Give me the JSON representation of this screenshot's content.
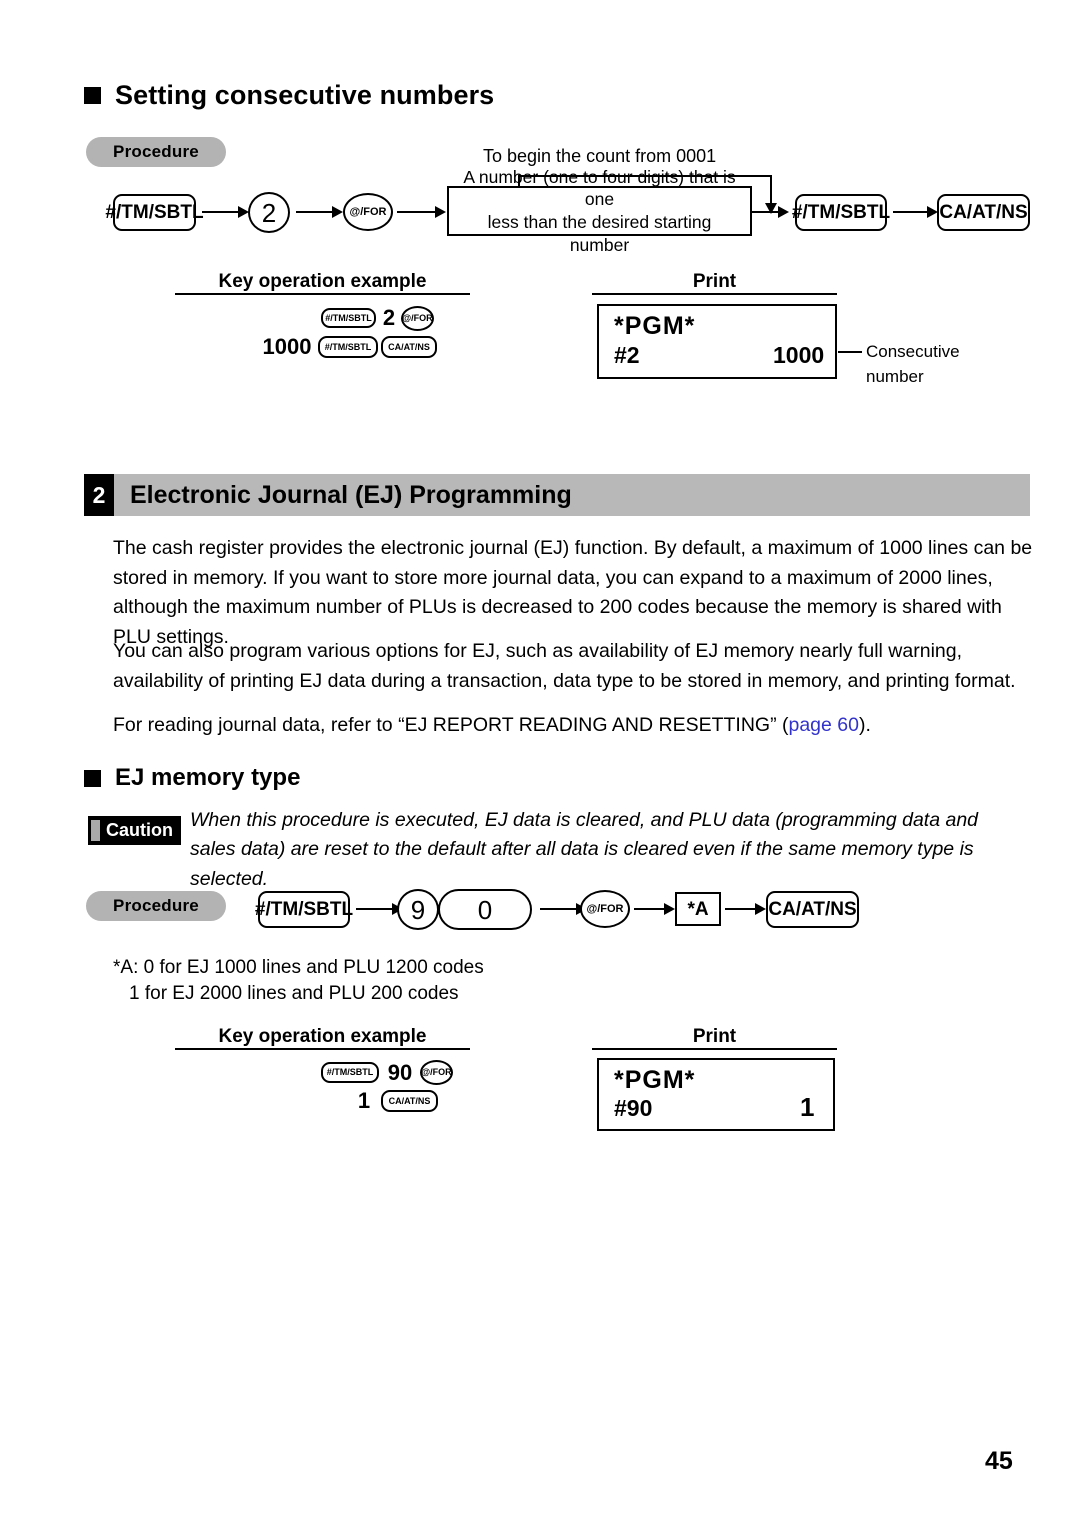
{
  "section1": {
    "heading": "Setting consecutive numbers",
    "procedure_label": "Procedure",
    "flow": {
      "key1": "#/TM/SBTL",
      "key2": "2",
      "key3": "@/FOR",
      "branch_label": "To begin the count from 0001",
      "callout_line1": "A number (one to four digits) that is one",
      "callout_line2": "less than the desired starting number",
      "key4": "#/TM/SBTL",
      "key5": "CA/AT/NS"
    },
    "example": {
      "header": "Key operation example",
      "row1_key1": "#/TM/SBTL",
      "row1_num": "2",
      "row1_key2": "@/FOR",
      "row2_num": "1000",
      "row2_key1": "#/TM/SBTL",
      "row2_key2": "CA/AT/NS"
    },
    "print": {
      "header": "Print",
      "pgm": "*PGM*",
      "code": "#2",
      "value": "1000",
      "annotation_line1": "Consecutive",
      "annotation_line2": "number"
    }
  },
  "section2": {
    "number": "2",
    "title": "Electronic Journal (EJ) Programming",
    "para1": "The cash register provides the electronic journal (EJ) function.  By default, a maximum of 1000 lines can be stored in memory.  If you want to store more journal data, you can expand to a maximum of 2000 lines, although the maximum number of PLUs is decreased to 200 codes because the memory is shared with PLU settings.",
    "para2": "You can also program various options for EJ, such as availability of EJ memory nearly full warning, availability of printing EJ data during a transaction, data type to be stored in memory, and printing format.",
    "para3_before": "For reading journal data, refer to “EJ REPORT READING AND RESETTING” (",
    "para3_link": "page 60",
    "para3_after": ")."
  },
  "section3": {
    "heading": "EJ memory type",
    "caution_label": "Caution",
    "caution_text": "When this procedure is executed, EJ data is cleared, and PLU data (programming data and sales data) are reset to the default after all data is cleared even if the same memory type is selected.",
    "procedure_label": "Procedure",
    "flow": {
      "key1": "#/TM/SBTL",
      "key2": "9",
      "key3": "0",
      "key4": "@/FOR",
      "key5": "*A",
      "key6": "CA/AT/NS"
    },
    "note_line1": "*A: 0 for EJ 1000 lines and PLU 1200 codes",
    "note_line2": "1 for EJ 2000 lines and PLU 200 codes",
    "example": {
      "header": "Key operation example",
      "row1_key1": "#/TM/SBTL",
      "row1_num": "90",
      "row1_key2": "@/FOR",
      "row2_num": "1",
      "row2_key1": "CA/AT/NS"
    },
    "print": {
      "header": "Print",
      "pgm": "*PGM*",
      "code": "#90",
      "value": "1"
    }
  },
  "footer": {
    "page_number": "45"
  },
  "colors": {
    "band_gray": "#b8b8b8",
    "pill_gray": "#b3b3b3",
    "link_blue": "#3333cc",
    "ink": "#000000"
  }
}
